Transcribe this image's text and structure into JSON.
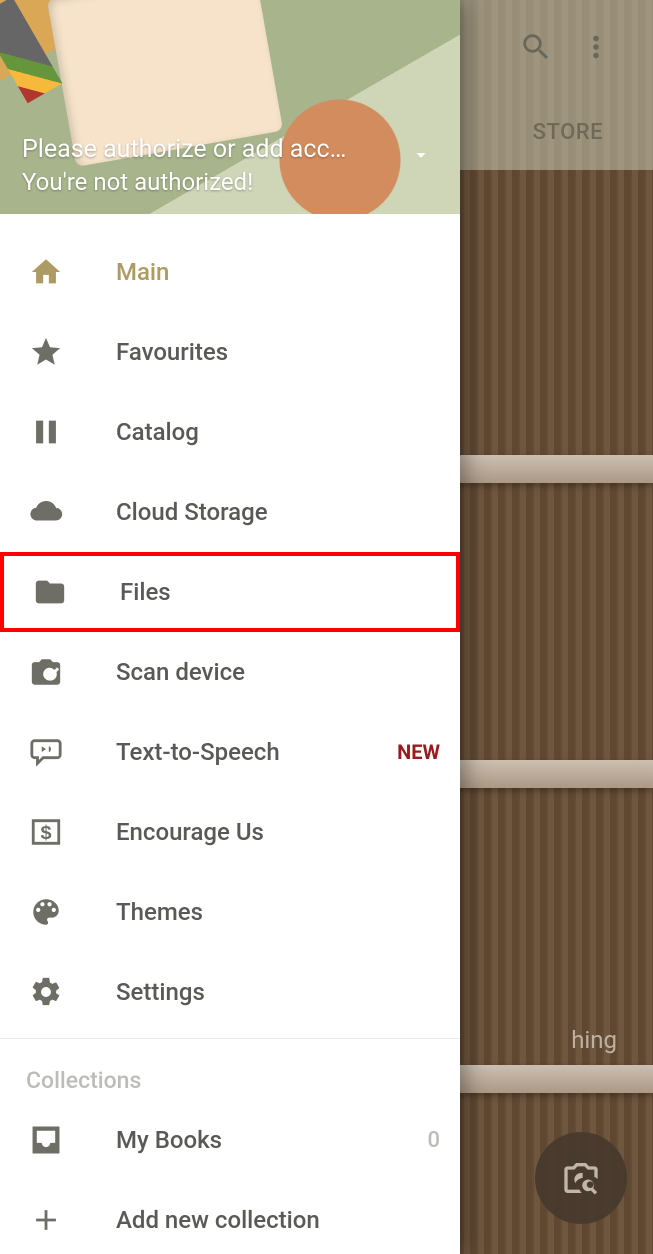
{
  "topbar": {
    "tab_store": "STORE"
  },
  "hint_text": "hing",
  "drawer": {
    "auth_line1": "Please authorize or add acco…",
    "auth_line2": "You're not authorized!"
  },
  "menu": {
    "main": "Main",
    "favourites": "Favourites",
    "catalog": "Catalog",
    "cloud": "Cloud Storage",
    "files": "Files",
    "scan": "Scan device",
    "tts": "Text-to-Speech",
    "tts_badge": "NEW",
    "encourage": "Encourage Us",
    "themes": "Themes",
    "settings": "Settings"
  },
  "collections": {
    "title": "Collections",
    "mybooks_label": "My Books",
    "mybooks_count": "0",
    "add_label": "Add new collection"
  }
}
